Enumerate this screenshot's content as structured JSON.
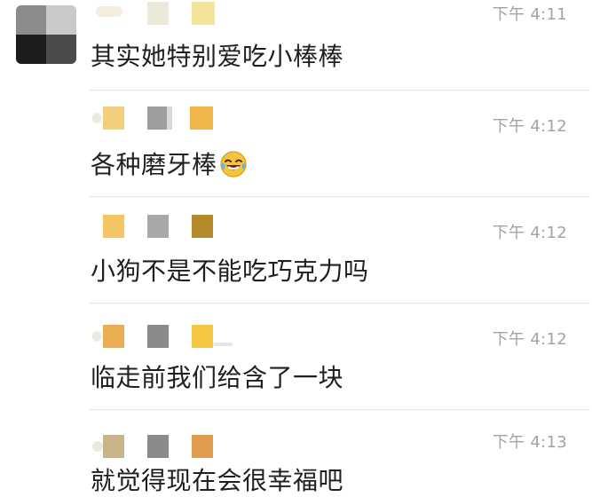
{
  "messages": [
    {
      "time": "下午 4:11",
      "text": "其实她特别爱吃小棒棒",
      "emoji": ""
    },
    {
      "time": "下午 4:12",
      "text": "各种磨牙棒",
      "emoji": "laughing-crying-emoji"
    },
    {
      "time": "下午 4:12",
      "text": "小狗不是不能吃巧克力吗",
      "emoji": ""
    },
    {
      "time": "下午 4:12",
      "text": "临走前我们给含了一块",
      "emoji": ""
    },
    {
      "time": "下午 4:13",
      "text": "就觉得现在会很幸福吧",
      "emoji": ""
    }
  ],
  "colors": {
    "time": "#a3a3a3",
    "text": "#1f1f1f",
    "divider": "#e3e3e3"
  }
}
